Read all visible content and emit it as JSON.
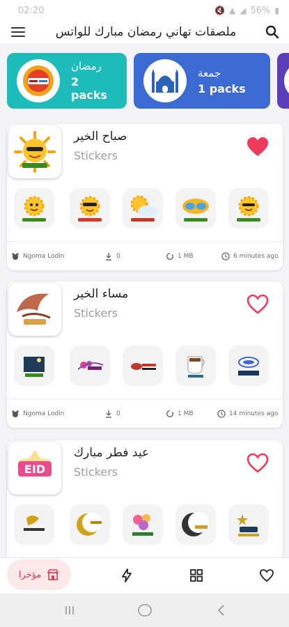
{
  "status_bar": {
    "time": "02:20",
    "battery": "56%"
  },
  "app_bar": {
    "title": "ملصقات تهاني رمضان مبارك للواتس"
  },
  "categories": [
    {
      "name": "رمضان",
      "count": "2 packs",
      "color": "#1dbbb9"
    },
    {
      "name": "جمعة",
      "count": "1 packs",
      "color": "#3c6ad3"
    },
    {
      "name": "",
      "count": "",
      "color": "#5a3fb8"
    }
  ],
  "packs": [
    {
      "name": "صباح الخير",
      "subtitle": "Stickers",
      "favorite": true,
      "author": "Ngoma Lodin",
      "downloads": "0",
      "size": "1 MB",
      "time": "6 minutes ago"
    },
    {
      "name": "مساء الخير",
      "subtitle": "Stickers",
      "favorite": false,
      "author": "Ngoma Lodin",
      "downloads": "0",
      "size": "1 MB",
      "time": "14 minutes ago"
    },
    {
      "name": "عيد فطر مبارك",
      "subtitle": "Stickers",
      "favorite": false
    }
  ],
  "bottom_nav": {
    "recent_label": "مؤخرا"
  },
  "colors": {
    "accent": "#e53950",
    "heart": "#ef3b5b",
    "teal": "#1dbbb9",
    "blue": "#3c6ad3"
  },
  "icons": {
    "menu": "menu-icon",
    "search": "search-icon",
    "heart": "heart-icon",
    "download": "download-icon",
    "size": "sync-icon",
    "time": "clock-icon",
    "author": "bear-icon",
    "recent": "store-icon",
    "trending": "lightning-icon",
    "categories": "grid-icon",
    "favorites": "heart-outline-icon"
  }
}
